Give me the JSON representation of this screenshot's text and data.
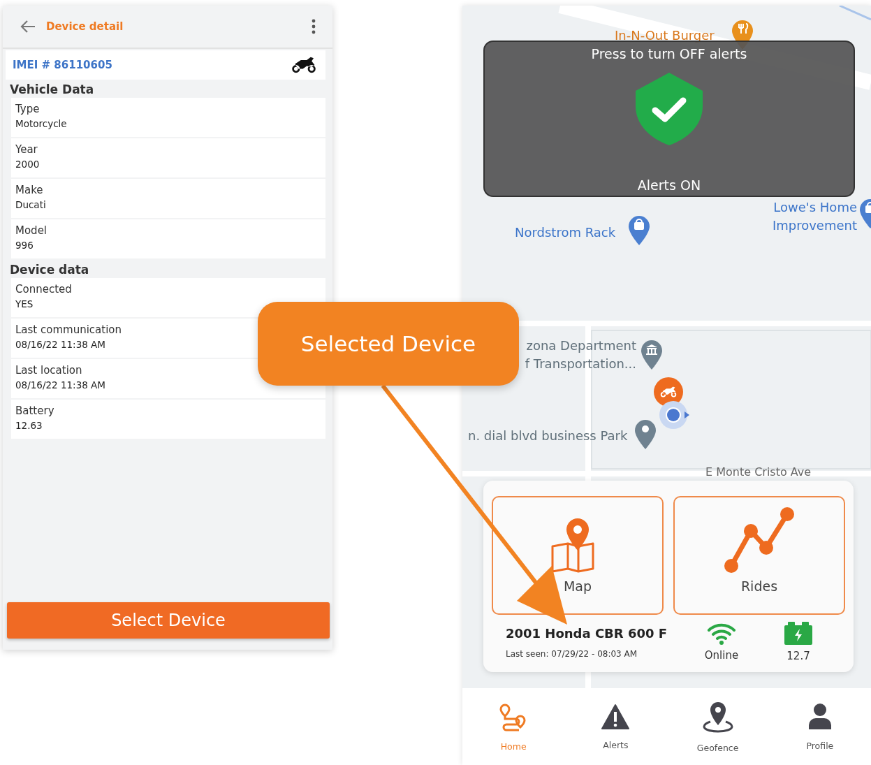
{
  "detail_screen": {
    "title": "Device detail",
    "imei": "IMEI # 86110605",
    "sections": [
      {
        "title": "Vehicle Data",
        "fields": [
          {
            "label": "Type",
            "value": "Motorcycle"
          },
          {
            "label": "Year",
            "value": "2000"
          },
          {
            "label": "Make",
            "value": "Ducati"
          },
          {
            "label": "Model",
            "value": "996"
          }
        ]
      },
      {
        "title": "Device data",
        "fields": [
          {
            "label": "Connected",
            "value": "YES"
          },
          {
            "label": "Last communication",
            "value": "08/16/22 11:38 AM"
          },
          {
            "label": "Last location",
            "value": "08/16/22 11:38 AM"
          },
          {
            "label": "Battery",
            "value": "12.63"
          }
        ]
      }
    ],
    "select_button": "Select Device"
  },
  "callout": {
    "text": "Selected Device"
  },
  "map_screen": {
    "alerts_overlay": {
      "hint": "Press to turn OFF alerts",
      "status": "Alerts ON",
      "on": true
    },
    "places": [
      {
        "lines": [
          "In-N-Out Burger"
        ],
        "kind": "food"
      },
      {
        "lines": [
          "Lowe's Home",
          "Improvement"
        ],
        "kind": "shop"
      },
      {
        "lines": [
          "Nordstrom Rack"
        ],
        "kind": "shop"
      },
      {
        "lines": [
          "zona Department",
          "f Transportation..."
        ],
        "kind": "office"
      },
      {
        "lines": [
          "n. dial blvd business Park"
        ],
        "kind": "place"
      }
    ],
    "street_label": "E Monte Cristo Ave",
    "tiles": [
      {
        "label": "Map",
        "kind": "map"
      },
      {
        "label": "Rides",
        "kind": "rides"
      }
    ],
    "vehicle": {
      "name": "2001 Honda CBR 600 F",
      "last_seen": "Last seen: 07/29/22 - 08:03 AM",
      "connection": "Online",
      "battery": "12.7"
    },
    "nav": [
      {
        "label": "Home",
        "kind": "home",
        "selected": true
      },
      {
        "label": "Alerts",
        "kind": "alerts",
        "selected": false
      },
      {
        "label": "Geofence",
        "kind": "geofence",
        "selected": false
      },
      {
        "label": "Profile",
        "kind": "profile",
        "selected": false
      }
    ]
  }
}
